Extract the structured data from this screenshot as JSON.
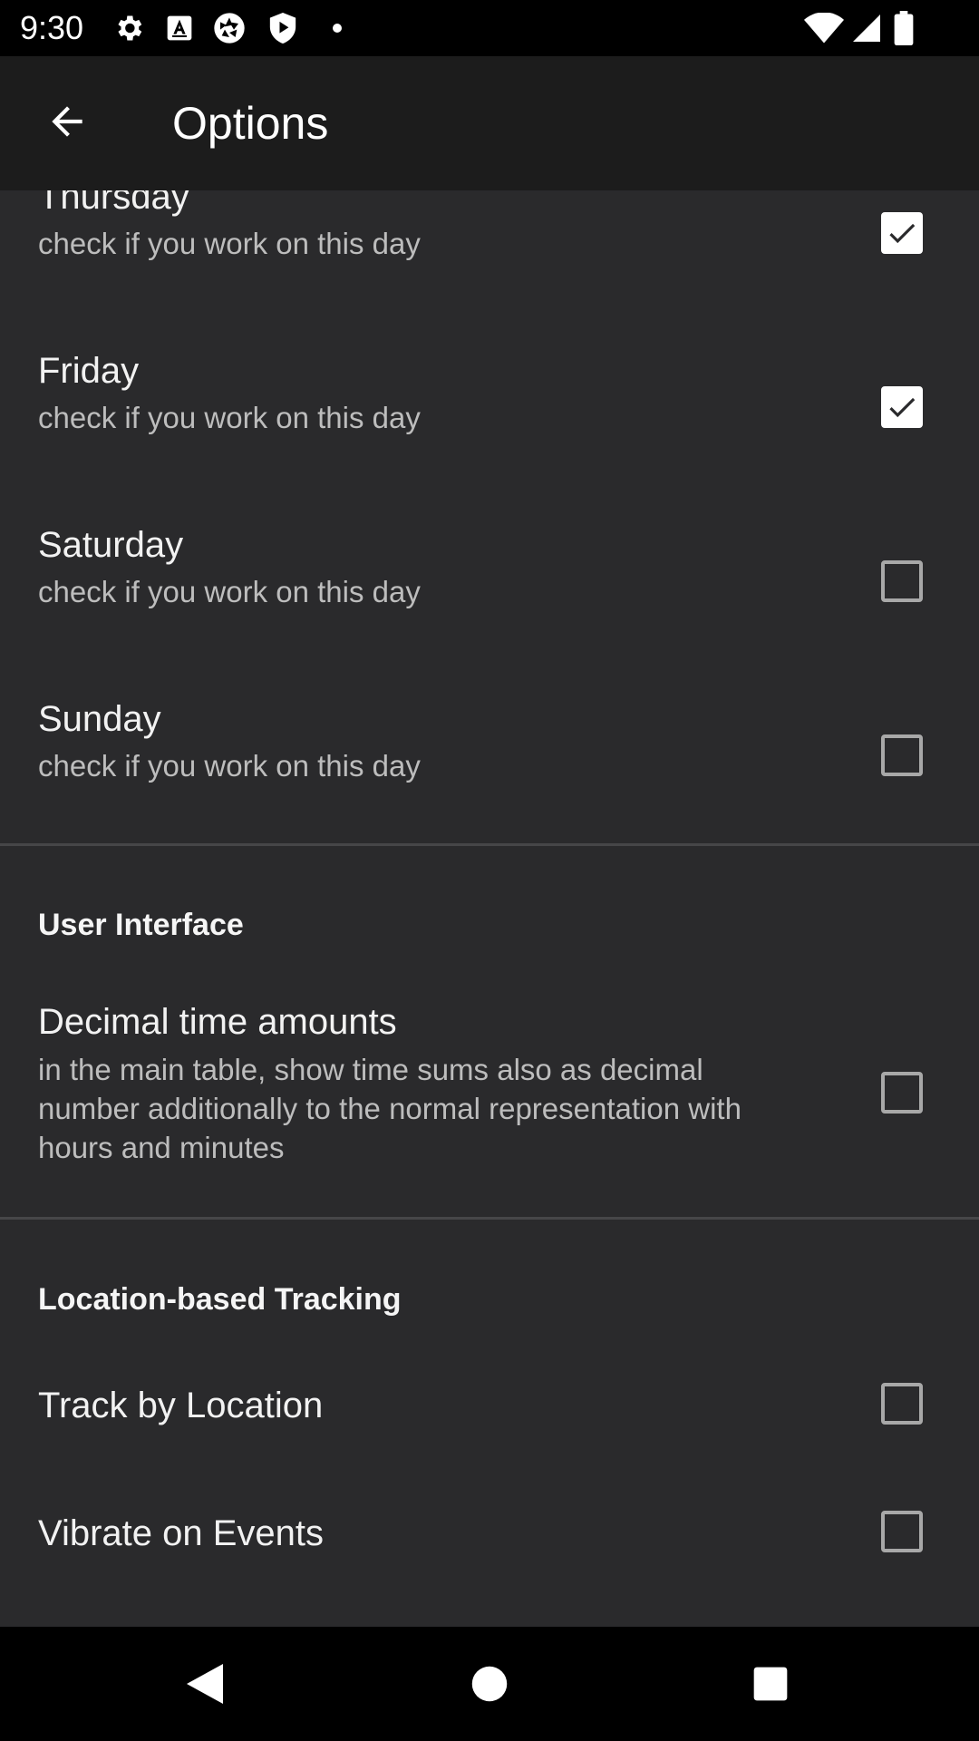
{
  "status_bar": {
    "time": "9:30",
    "left_icons": [
      "gear-icon",
      "font-icon",
      "camera-aperture-icon",
      "shield-play-icon",
      "dot-icon"
    ],
    "right_icons": [
      "wifi-icon",
      "cellular-signal-icon",
      "battery-icon"
    ]
  },
  "app_bar": {
    "back_icon": "arrow-back-icon",
    "title": "Options"
  },
  "workdays": [
    {
      "title": "Thursday",
      "summary": "check if you work on this day",
      "checked": true
    },
    {
      "title": "Friday",
      "summary": "check if you work on this day",
      "checked": true
    },
    {
      "title": "Saturday",
      "summary": "check if you work on this day",
      "checked": false
    },
    {
      "title": "Sunday",
      "summary": "check if you work on this day",
      "checked": false
    }
  ],
  "user_interface": {
    "category": "User Interface",
    "decimal_time": {
      "title": "Decimal time amounts",
      "summary": "in the main table, show time sums also as decimal number additionally to the normal representation with hours and minutes",
      "checked": false
    }
  },
  "location_tracking": {
    "category": "Location-based Tracking",
    "track_by_location": {
      "title": "Track by Location",
      "checked": false
    },
    "vibrate_on_events": {
      "title": "Vibrate on Events",
      "checked": false
    }
  },
  "nav_bar": {
    "icons": [
      "back-triangle-icon",
      "home-circle-icon",
      "recents-square-icon"
    ]
  },
  "colors": {
    "background": "#2a2a2c",
    "app_bar": "#1c1c1c",
    "status_bar": "#000000",
    "checkbox_checked": "#ffffff",
    "checkbox_unchecked_border": "#a8a8a8"
  }
}
